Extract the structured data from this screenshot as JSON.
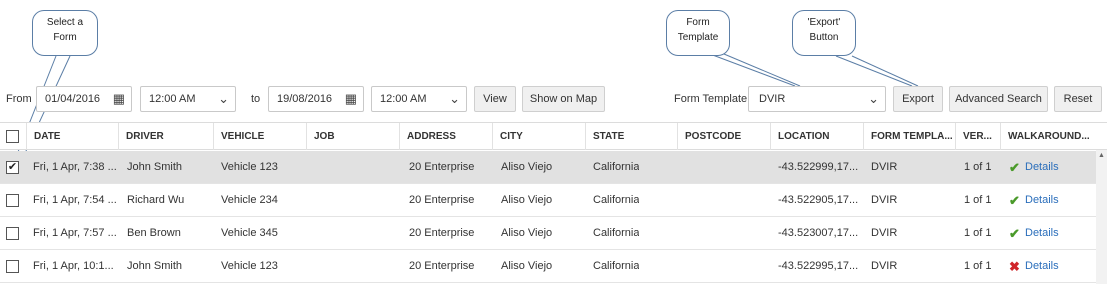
{
  "callouts": {
    "select_form": "Select a\nForm",
    "form_template": "Form\nTemplate",
    "export_button": "'Export'\nButton"
  },
  "filters": {
    "from_label": "From",
    "from_date": "01/04/2016",
    "from_time": "12:00 AM",
    "to_label": "to",
    "to_date": "19/08/2016",
    "to_time": "12:00 AM",
    "view_label": "View",
    "show_on_map_label": "Show on Map",
    "form_template_label": "Form Template:",
    "form_template_value": "DVIR",
    "export_label": "Export",
    "advanced_search_label": "Advanced Search",
    "reset_label": "Reset"
  },
  "table": {
    "headers": [
      "DATE",
      "DRIVER",
      "VEHICLE",
      "JOB",
      "ADDRESS",
      "CITY",
      "STATE",
      "POSTCODE",
      "LOCATION",
      "FORM TEMPLA...",
      "VER...",
      "WALKAROUND..."
    ],
    "rows": [
      {
        "checked": true,
        "date": "Fri, 1 Apr, 7:38 ...",
        "driver": "John Smith",
        "vehicle": "Vehicle 123",
        "job": "",
        "address": "20 Enterprise",
        "city": "Aliso Viejo",
        "state": "California",
        "postcode": "",
        "location": "-43.522999,17...",
        "form_template": "DVIR",
        "version": "1 of 1",
        "walkaround_status": "pass",
        "walkaround_link": "Details"
      },
      {
        "checked": false,
        "date": "Fri, 1 Apr, 7:54 ...",
        "driver": "Richard Wu",
        "vehicle": "Vehicle 234",
        "job": "",
        "address": "20 Enterprise",
        "city": "Aliso Viejo",
        "state": "California",
        "postcode": "",
        "location": "-43.522905,17...",
        "form_template": "DVIR",
        "version": "1 of 1",
        "walkaround_status": "pass",
        "walkaround_link": "Details"
      },
      {
        "checked": false,
        "date": "Fri, 1 Apr, 7:57 ...",
        "driver": "Ben Brown",
        "vehicle": "Vehicle 345",
        "job": "",
        "address": "20 Enterprise",
        "city": "Aliso Viejo",
        "state": "California",
        "postcode": "",
        "location": "-43.523007,17...",
        "form_template": "DVIR",
        "version": "1 of 1",
        "walkaround_status": "pass",
        "walkaround_link": "Details"
      },
      {
        "checked": false,
        "date": "Fri, 1 Apr, 10:1...",
        "driver": "John Smith",
        "vehicle": "Vehicle 123",
        "job": "",
        "address": "20 Enterprise",
        "city": "Aliso Viejo",
        "state": "California",
        "postcode": "",
        "location": "-43.522995,17...",
        "form_template": "DVIR",
        "version": "1 of 1",
        "walkaround_status": "fail",
        "walkaround_link": "Details"
      }
    ]
  },
  "colors": {
    "pass": "#4a9a2a",
    "fail": "#d0252a",
    "link": "#2a6ebb",
    "callout_border": "#5b7ea6"
  },
  "icons": {
    "date_picker": "calendar-icon",
    "dropdown": "chevron-down-icon",
    "pass": "check-icon",
    "fail": "cross-icon",
    "scroll_up": "scroll-up-arrow-icon"
  }
}
